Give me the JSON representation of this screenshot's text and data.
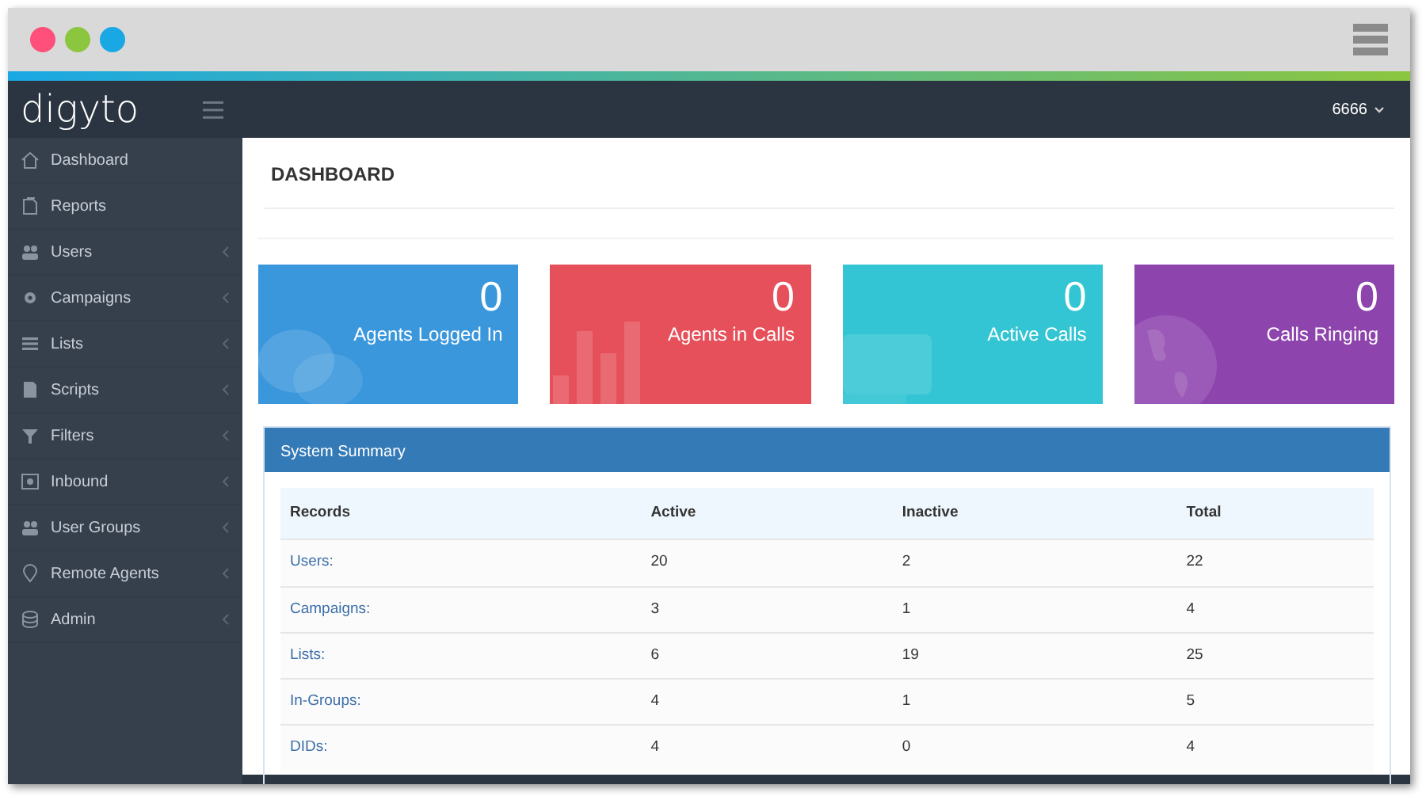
{
  "browser": {
    "dots": [
      {
        "color": "#ff4f7b"
      },
      {
        "color": "#8cc63f"
      },
      {
        "color": "#1aa8e4"
      }
    ]
  },
  "header": {
    "logo": "digyto",
    "user": "6666"
  },
  "sidebar": {
    "items": [
      {
        "label": "Dashboard",
        "expandable": false
      },
      {
        "label": "Reports",
        "expandable": false
      },
      {
        "label": "Users",
        "expandable": true
      },
      {
        "label": "Campaigns",
        "expandable": true
      },
      {
        "label": "Lists",
        "expandable": true
      },
      {
        "label": "Scripts",
        "expandable": true
      },
      {
        "label": "Filters",
        "expandable": true
      },
      {
        "label": "Inbound",
        "expandable": true
      },
      {
        "label": "User Groups",
        "expandable": true
      },
      {
        "label": "Remote Agents",
        "expandable": true
      },
      {
        "label": "Admin",
        "expandable": true
      }
    ]
  },
  "page_title": "DASHBOARD",
  "stats": [
    {
      "value": "0",
      "label": "Agents Logged In",
      "color": "#3a97dc"
    },
    {
      "value": "0",
      "label": "Agents in Calls",
      "color": "#e6505a"
    },
    {
      "value": "0",
      "label": "Active Calls",
      "color": "#33c5d3"
    },
    {
      "value": "0",
      "label": "Calls Ringing",
      "color": "#8e44ad"
    }
  ],
  "summary": {
    "title": "System Summary",
    "columns": [
      "Records",
      "Active",
      "Inactive",
      "Total"
    ],
    "rows": [
      [
        "Users:",
        "20",
        "2",
        "22"
      ],
      [
        "Campaigns:",
        "3",
        "1",
        "4"
      ],
      [
        "Lists:",
        "6",
        "19",
        "25"
      ],
      [
        "In-Groups:",
        "4",
        "1",
        "5"
      ],
      [
        "DIDs:",
        "4",
        "0",
        "4"
      ]
    ]
  }
}
